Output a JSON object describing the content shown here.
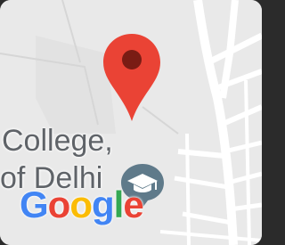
{
  "map": {
    "place_label_line1": "College,",
    "place_label_line2": "of Delhi",
    "pin_icon": "location-pin-icon",
    "place_icon": "graduation-cap-icon",
    "colors": {
      "background": "#e9e9e9",
      "road": "#ffffff",
      "pin": "#ea4335",
      "pin_dot": "#7a1c14",
      "place_icon_bg": "#5f7a8a",
      "label_text": "#5f6368"
    }
  },
  "logo": {
    "letters": [
      "G",
      "o",
      "o",
      "g",
      "l",
      "e"
    ],
    "colors": [
      "#4285f4",
      "#ea4335",
      "#fbbc05",
      "#4285f4",
      "#34a853",
      "#ea4335"
    ]
  }
}
